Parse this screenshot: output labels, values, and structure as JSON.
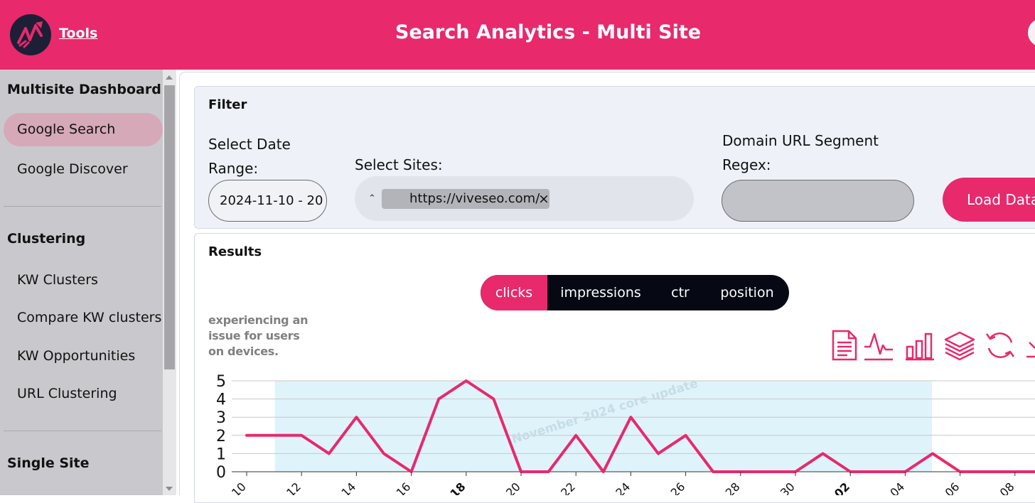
{
  "header": {
    "tools_link": "Tools",
    "title": "Search Analytics - Multi Site"
  },
  "sidebar": {
    "sections": [
      {
        "heading": "Multisite Dashboard",
        "items": [
          "Google Search",
          "Google Discover"
        ]
      },
      {
        "heading": "Clustering",
        "items": [
          "KW Clusters",
          "Compare KW clusters",
          "KW Opportunities",
          "URL Clustering"
        ]
      },
      {
        "heading": "Single Site",
        "items": []
      }
    ],
    "active_item": "Google Search"
  },
  "filter": {
    "title": "Filter",
    "date_label_line1": "Select Date",
    "date_label_line2": "Range:",
    "date_value": "2024-11-10 - 20",
    "sites_label": "Select Sites:",
    "site_chip": "https://viveseo.com/",
    "chip_remove": "×",
    "regex_label_line1": "Domain URL Segment",
    "regex_label_line2": "Regex:",
    "regex_value": "",
    "load_button": "Load Data"
  },
  "results": {
    "title": "Results",
    "metric_tabs": [
      "clicks",
      "impressions",
      "ctr",
      "position"
    ],
    "active_metric": "clicks",
    "overlay_text_lines": [
      "experiencing an",
      "issue for users",
      "on devices."
    ],
    "toolbar_icons": [
      "document-icon",
      "line-chart-icon",
      "bar-chart-icon",
      "layers-icon",
      "refresh-icon",
      "download-icon"
    ]
  },
  "colors": {
    "brand": "#e8296c",
    "dark": "#060914",
    "sidebar_bg": "#c9c9cd",
    "band": "#dff3fb"
  },
  "chart_data": {
    "type": "line",
    "series": [
      {
        "values": [
          2,
          2,
          2,
          1,
          3,
          1,
          0,
          4,
          5,
          4,
          0,
          0,
          2,
          0,
          3,
          1,
          2,
          0,
          0,
          0,
          0,
          1,
          0,
          0,
          0,
          1,
          0,
          0,
          0,
          0
        ]
      }
    ],
    "ylim": [
      0,
      5
    ],
    "yticks": [
      0,
      1,
      2,
      3,
      4,
      5
    ],
    "xtick_labels": [
      "1-10",
      "1-12",
      "1-14",
      "1-16",
      "1-18",
      "1-20",
      "1-22",
      "1-24",
      "1-26",
      "1-28",
      "1-30",
      "2-02",
      "2-04",
      "2-06",
      "2-08"
    ],
    "annotation": "November 2024 core update",
    "band_start_index": 1,
    "band_end_index": 25
  }
}
